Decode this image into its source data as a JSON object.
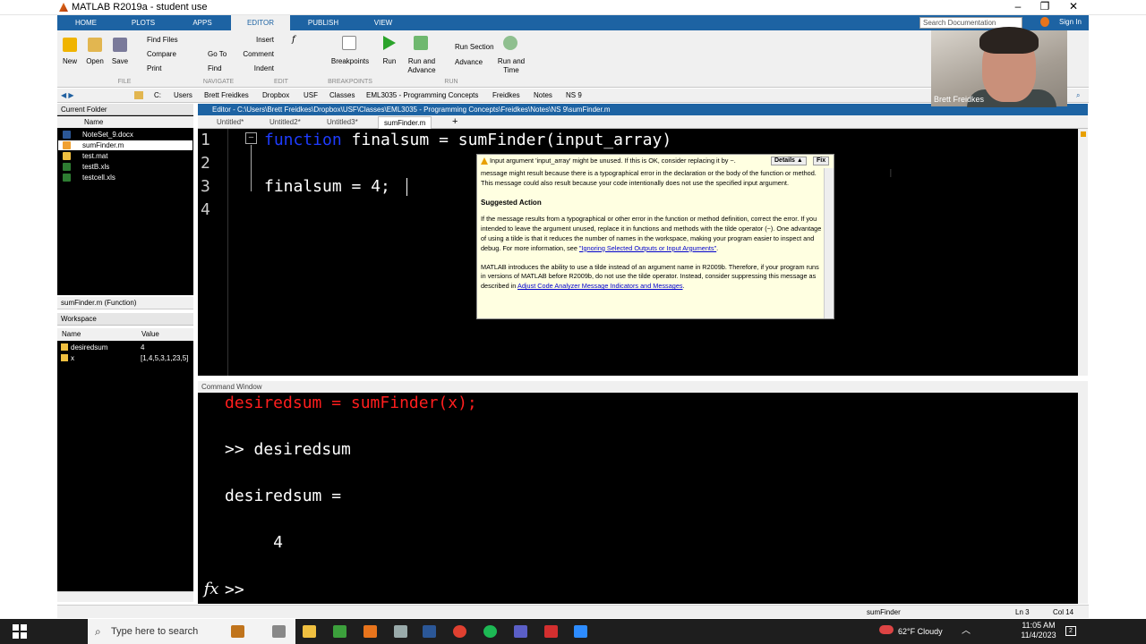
{
  "window": {
    "title": "MATLAB R2019a - student use",
    "minimize": "–",
    "restore": "❐",
    "close": "✕"
  },
  "tabs": [
    "HOME",
    "PLOTS",
    "APPS",
    "EDITOR",
    "PUBLISH",
    "VIEW"
  ],
  "search_placeholder": "Search Documentation",
  "sign_in": "Sign In",
  "toolstrip": {
    "file": {
      "new": "New",
      "open": "Open",
      "save": "Save",
      "find_files": "Find Files",
      "compare": "Compare",
      "print": "Print",
      "group": "FILE"
    },
    "navigate": {
      "go_to": "Go To",
      "find": "Find",
      "group": "NAVIGATE"
    },
    "edit": {
      "insert": "Insert",
      "comment": "Comment",
      "indent": "Indent",
      "group": "EDIT"
    },
    "breakpoints": {
      "label": "Breakpoints",
      "group": "BREAKPOINTS"
    },
    "run": {
      "run": "Run",
      "run_advance": "Run and\nAdvance",
      "run_section": "Run Section",
      "advance": "Advance",
      "run_time": "Run and\nTime",
      "group": "RUN"
    }
  },
  "address_bar": [
    "C:",
    "Users",
    "Brett Freidkes",
    "Dropbox",
    "USF",
    "Classes",
    "EML3035 - Programming Concepts",
    "Freidkes",
    "Notes",
    "NS 9"
  ],
  "current_folder": {
    "title": "Current Folder",
    "column": "Name",
    "files": [
      {
        "name": "NoteSet_9.docx",
        "selected": false
      },
      {
        "name": "sumFinder.m",
        "selected": true
      },
      {
        "name": "test.mat",
        "selected": false
      },
      {
        "name": "testB.xls",
        "selected": false
      },
      {
        "name": "testcell.xls",
        "selected": false
      }
    ]
  },
  "function_bar": "sumFinder.m (Function)",
  "workspace": {
    "title": "Workspace",
    "col_name": "Name",
    "col_value": "Value",
    "rows": [
      {
        "name": "desiredsum",
        "value": "4"
      },
      {
        "name": "x",
        "value": "[1,4,5,3,1,23,5]"
      }
    ]
  },
  "editor": {
    "title": "Editor - C:\\Users\\Brett Freidkes\\Dropbox\\USF\\Classes\\EML3035 - Programming Concepts\\Freidkes\\Notes\\NS 9\\sumFinder.m",
    "tabs": [
      "Untitled*",
      "Untitled2*",
      "Untitled3*",
      "sumFinder.m"
    ],
    "add_tab": "+",
    "line_numbers": [
      "1",
      "2",
      "3",
      "4"
    ],
    "line1_kw": "function",
    "line1_rest": " finalsum = sumFinder(input_array)",
    "line3": "finalsum = 4;"
  },
  "tooltip": {
    "header": "Input argument 'input_array' might be unused. If this is OK, consider replacing it by ~.",
    "details_btn": "Details ▲",
    "fix_btn": "Fix",
    "para1": "message might result because there is a typographical error in the declaration or the body of the function or method. This message could also result because your code intentionally does not use the specified input argument.",
    "suggested": "Suggested Action",
    "para2": "If the message results from a typographical or other error in the function or method definition, correct the error. If you intended to leave the argument unused, replace it in functions and methods with the tilde operator (~). One advantage of using a tilde is that it reduces the number of names in the workspace, making your program easier to inspect and debug. For more information, see",
    "link1": "\"Ignoring Selected Outputs or Input Arguments\"",
    "para3": "MATLAB introduces the ability to use a tilde instead of an argument name in R2009b. Therefore, if your program runs in versions of MATLAB before R2009b, do not use the tilde operator. Instead, consider suppressing this message as described in",
    "link2": "Adjust Code Analyzer Message Indicators and Messages"
  },
  "command_window": {
    "title": "Command Window",
    "l1": "desiredsum = sumFinder(x);",
    "l2": ">> desiredsum",
    "l3": "desiredsum =",
    "l4": "     4",
    "prompt": ">>",
    "fx": "fx"
  },
  "status": {
    "file": "sumFinder",
    "ln": "Ln  3",
    "col": "Col  14"
  },
  "taskbar": {
    "search": "Type here to search",
    "weather": "62°F  Cloudy",
    "time": "11:05 AM",
    "date": "11/4/2023",
    "notifications": "2"
  },
  "webcam": {
    "name": "Brett Freidkes"
  }
}
